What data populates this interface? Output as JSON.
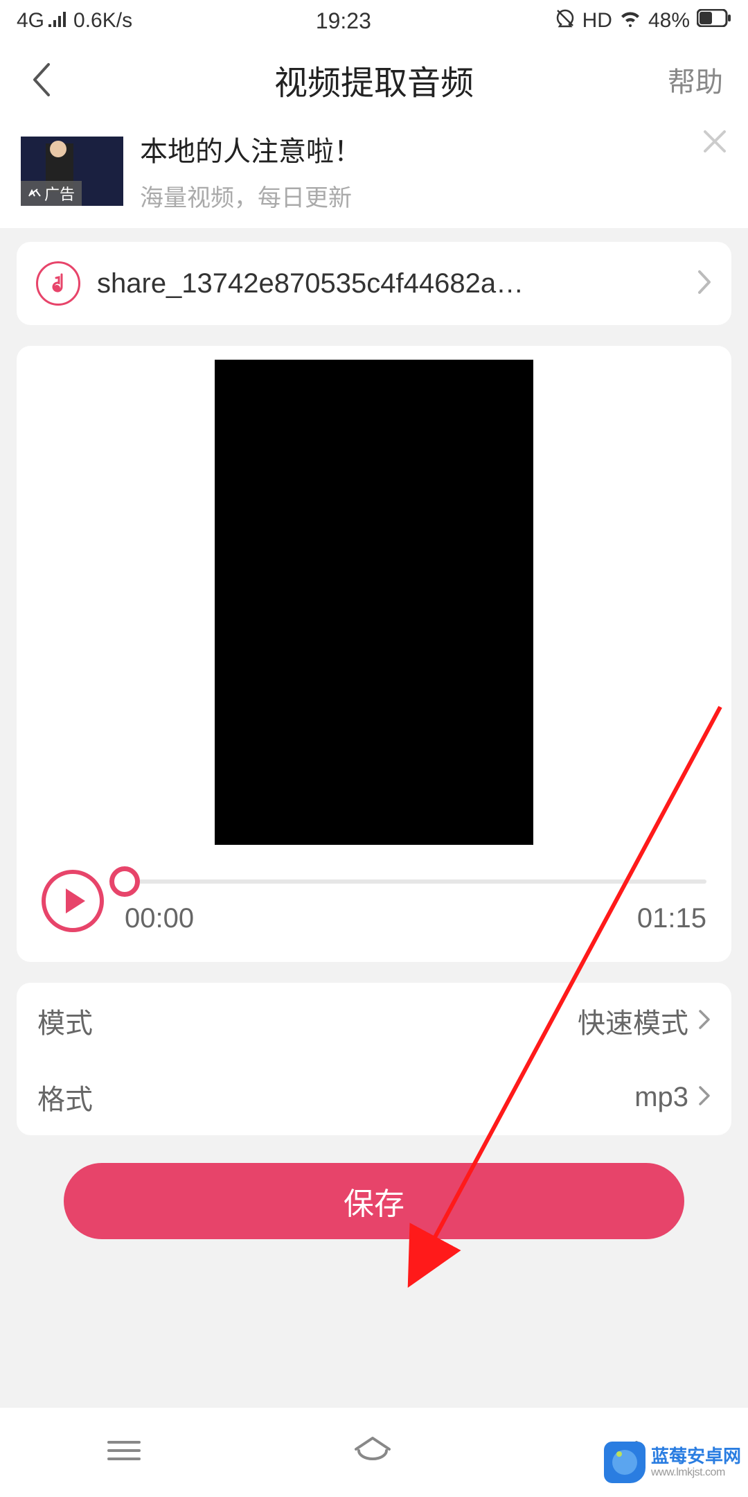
{
  "status": {
    "network": "4G",
    "speed": "0.6K/s",
    "time": "19:23",
    "hd": "HD",
    "battery_pct": "48%"
  },
  "header": {
    "title": "视频提取音频",
    "help": "帮助"
  },
  "ad": {
    "title": "本地的人注意啦！",
    "subtitle": "海量视频，每日更新",
    "tag": "广告"
  },
  "file": {
    "name": "share_13742e870535c4f44682a…"
  },
  "player": {
    "current": "00:00",
    "duration": "01:15"
  },
  "options": {
    "mode_label": "模式",
    "mode_value": "快速模式",
    "format_label": "格式",
    "format_value": "mp3"
  },
  "actions": {
    "save": "保存"
  },
  "watermark": {
    "line1": "蓝莓安卓网",
    "line2": "www.lmkjst.com"
  }
}
